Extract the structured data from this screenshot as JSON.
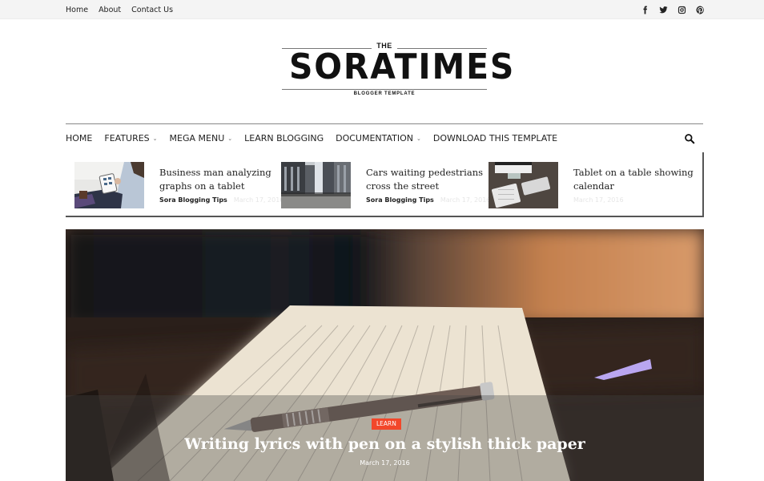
{
  "topbar": {
    "links": [
      "Home",
      "About",
      "Contact Us"
    ],
    "social": [
      "facebook-icon",
      "twitter-icon",
      "instagram-icon",
      "pinterest-icon"
    ]
  },
  "logo": {
    "the": "THE",
    "name": "SORATIMES",
    "tagline": "BLOGGER TEMPLATE"
  },
  "nav": {
    "items": [
      {
        "label": "HOME",
        "dropdown": false
      },
      {
        "label": "FEATURES",
        "dropdown": true
      },
      {
        "label": "MEGA MENU",
        "dropdown": true
      },
      {
        "label": "LEARN BLOGGING",
        "dropdown": false
      },
      {
        "label": "DOCUMENTATION",
        "dropdown": true
      },
      {
        "label": "DOWNLOAD THIS TEMPLATE",
        "dropdown": false
      }
    ],
    "chevron": "⌄",
    "search_icon": "search-icon"
  },
  "ticker": {
    "items": [
      {
        "title": "Business man analyzing graphs on a tablet",
        "author": "Sora Blogging Tips",
        "date": "March 17, 2016"
      },
      {
        "title": "Cars waiting pedestrians cross the street",
        "author": "Sora Blogging Tips",
        "date": "March 17, 2016"
      },
      {
        "title": "Tablet on a table showing calendar",
        "author": "",
        "date": "March 17, 2016"
      }
    ]
  },
  "hero": {
    "category": "LEARN",
    "title": "Writing lyrics with pen on a stylish thick paper",
    "date": "March 17, 2016",
    "accent_color": "#f2472a"
  }
}
